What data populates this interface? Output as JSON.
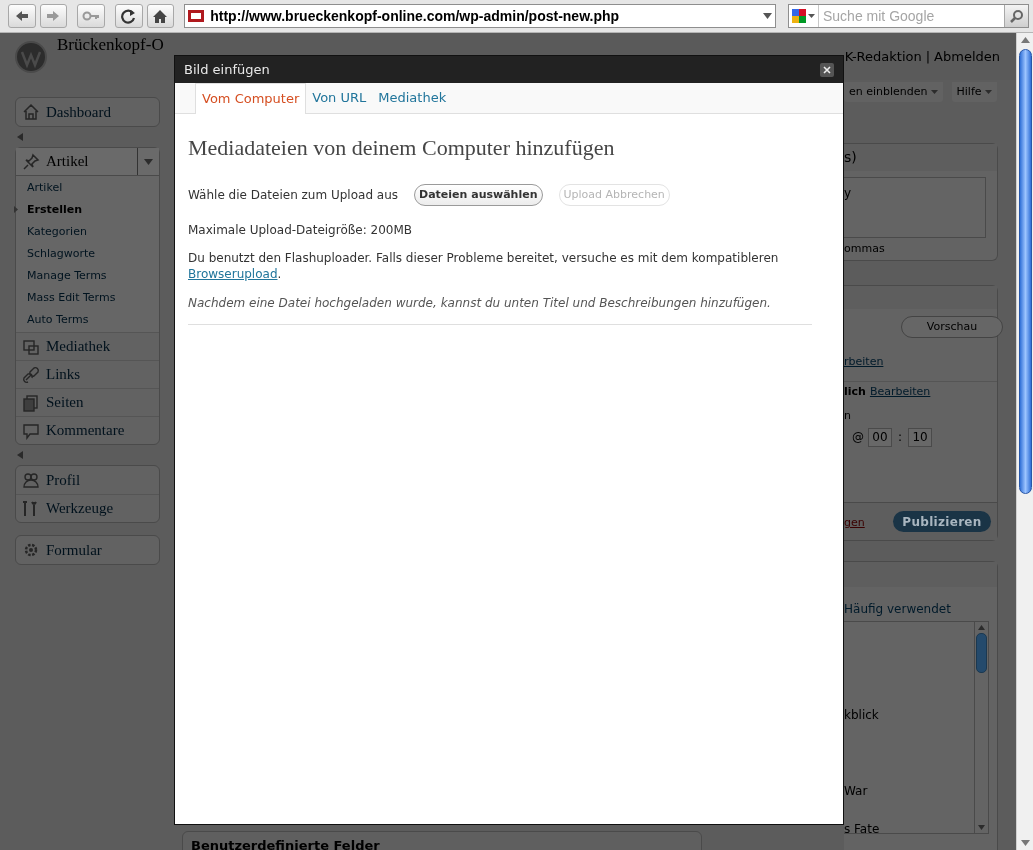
{
  "browser": {
    "url": "http://www.brueckenkopf-online.com/wp-admin/post-new.php",
    "search": {
      "placeholder": "Suche mit Google"
    }
  },
  "header": {
    "site_title": "Brückenkopf-O",
    "user": "K-Redaktion",
    "separator": "|",
    "logout": "Abmelden"
  },
  "screen_meta": [
    "en einblenden",
    "Hilfe"
  ],
  "sidebar": {
    "groups": [
      [
        {
          "label": "Dashboard",
          "expanded": false
        }
      ],
      [
        {
          "label": "Artikel",
          "expanded": true,
          "children": [
            {
              "label": "Artikel",
              "selected": false
            },
            {
              "label": "Erstellen",
              "selected": true
            },
            {
              "label": "Kategorien",
              "selected": false
            },
            {
              "label": "Schlagworte",
              "selected": false
            },
            {
              "label": "Manage Terms",
              "selected": false
            },
            {
              "label": "Mass Edit Terms",
              "selected": false
            },
            {
              "label": "Auto Terms",
              "selected": false
            }
          ]
        },
        {
          "label": "Mediathek",
          "expanded": false
        },
        {
          "label": "Links",
          "expanded": false
        },
        {
          "label": "Seiten",
          "expanded": false
        },
        {
          "label": "Kommentare",
          "expanded": false
        }
      ],
      [
        {
          "label": "Profil",
          "expanded": false
        },
        {
          "label": "Werkzeuge",
          "expanded": false
        }
      ],
      [
        {
          "label": "Formular",
          "expanded": false
        }
      ]
    ]
  },
  "main": {
    "custom_fields_title": "Benutzerdefinierte Felder"
  },
  "tags_box": {
    "title": "s)",
    "field_value": "y",
    "hint": "ommas"
  },
  "publish_box": {
    "preview": "Vorschau",
    "status_link": "rbeiten",
    "visibility_label": "lich",
    "visibility_link": "Bearbeiten",
    "schedule_label": "n",
    "time": {
      "at": "@",
      "hour": "00",
      "separator": ":",
      "minute": "10"
    },
    "delete_link": "gen",
    "publish": "Publizieren"
  },
  "categories_box": {
    "tab": "Häufig verwendet",
    "items": [
      "kblick",
      "War",
      "s Fate"
    ]
  },
  "dialog": {
    "title": "Bild einfügen",
    "tabs": [
      {
        "label": "Vom Computer",
        "selected": true
      },
      {
        "label": "Von URL",
        "selected": false
      },
      {
        "label": "Mediathek",
        "selected": false
      }
    ],
    "heading": "Mediadateien von deinem Computer hinzufügen",
    "choose_label": "Wähle die Dateien zum Upload aus",
    "buttons": [
      {
        "label": "Dateien auswählen",
        "disabled": false
      },
      {
        "label": "Upload Abbrechen",
        "disabled": true
      }
    ],
    "max_size": "Maximale Upload-Dateigröße: 200MB",
    "flash_note": "Du benutzt den Flashuploader. Falls dieser Probleme bereitet, versuche es mit dem kompatibleren",
    "flash_link": "Browserupload",
    "flash_tail": ".",
    "hint": "Nachdem eine Datei hochgeladen wurde, kannst du unten Titel und Beschreibungen hinzufügen."
  }
}
